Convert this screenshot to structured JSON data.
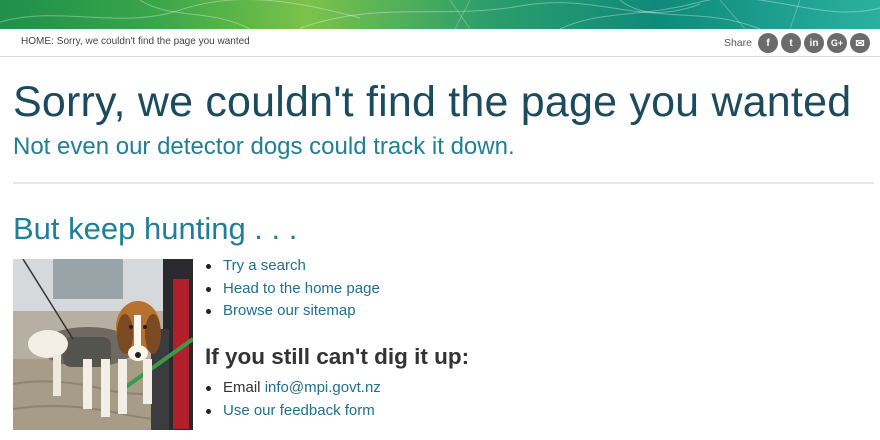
{
  "breadcrumb": {
    "home": "HOME:",
    "current": "Sorry, we couldn't find the page you wanted"
  },
  "share": {
    "label": "Share",
    "icons": [
      "facebook-icon",
      "twitter-icon",
      "linkedin-icon",
      "google-plus-icon",
      "email-icon"
    ],
    "glyphs": [
      "f",
      "t",
      "in",
      "G+",
      "✉"
    ]
  },
  "main": {
    "title": "Sorry, we couldn't find the page you wanted",
    "subtitle": "Not even our detector dogs could track it down.",
    "keep_hunting": "But keep hunting . . .",
    "links": [
      "Try a search",
      "Head to the home page",
      "Browse our sitemap"
    ],
    "dig_heading": "If you still can't dig it up:",
    "email_prefix": "Email",
    "email": "info@mpi.govt.nz",
    "feedback": "Use our feedback form"
  },
  "colors": {
    "title": "#1c4a5e",
    "accent": "#1f7f96",
    "link": "#1f6f8e"
  }
}
